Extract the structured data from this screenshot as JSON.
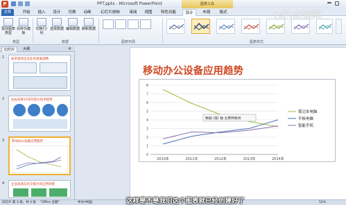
{
  "window": {
    "title": "PPT.pptx - Microsoft PowerPoint",
    "contextual_header": "图表工具"
  },
  "tabs": [
    "文件",
    "开始",
    "插入",
    "设计",
    "切换",
    "动画",
    "幻灯片放映",
    "审阅",
    "视图",
    "特色功能",
    "设计",
    "布局",
    "格式"
  ],
  "ribbon": {
    "type_group": {
      "label": "类型",
      "buttons": [
        "更改图表类型",
        "另存为模板"
      ]
    },
    "data_group": {
      "label": "数据",
      "buttons": [
        "切换行/列",
        "选择数据",
        "编辑数据",
        "刷新数据"
      ]
    },
    "layout_group": {
      "label": "图表布局"
    },
    "styles_group": {
      "label": "图表样式"
    }
  },
  "left_pane": {
    "tabs": [
      "幻灯片",
      "大纲"
    ],
    "slides": [
      {
        "num": "1",
        "title": "技术驱动企业业务发展战略"
      },
      {
        "num": "2",
        "title": "左右未来10年的四大技术趋势"
      },
      {
        "num": "3",
        "title": "移动办公设备应用趋势"
      },
      {
        "num": "4",
        "title": "企业高速与社交能力的应用场景"
      }
    ]
  },
  "slide": {
    "title": "移动办公设备应用趋势",
    "tooltip": "数据 (值) 轴 主要网格线"
  },
  "chart_data": {
    "type": "line",
    "x": [
      "2010年",
      "2011年",
      "2012年",
      "2013年",
      "2014年"
    ],
    "ylim": [
      0,
      8
    ],
    "yticks": [
      "0",
      "1",
      "2",
      "3",
      "4",
      "5",
      "6",
      "7",
      "8"
    ],
    "series": [
      {
        "name": "笔记本电脑",
        "values": [
          7.5,
          5.9,
          4.6,
          3.8,
          3.2
        ],
        "color": "#9dbb3c"
      },
      {
        "name": "平板电脑",
        "values": [
          1.2,
          2.1,
          2.6,
          3.0,
          4.0
        ],
        "color": "#4a6fb5"
      },
      {
        "name": "智能手机",
        "values": [
          1.8,
          2.6,
          2.5,
          2.8,
          3.3
        ],
        "color": "#8a6fae"
      }
    ],
    "legend": "right",
    "grid": true
  },
  "status": {
    "left": "幻灯片 第 3 张，共 4 张",
    "theme": "\"Office 主题\"",
    "lang": "中文(中国)",
    "zoom": "52%"
  },
  "overlay": {
    "subtitle": "这样是不是我们这个图表就已经创建好了",
    "watermark": "虎课网"
  }
}
